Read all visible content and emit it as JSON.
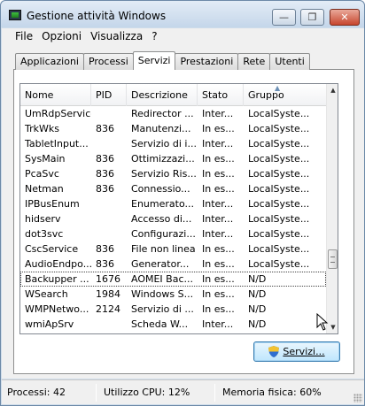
{
  "window": {
    "title": "Gestione attività Windows",
    "min_glyph": "—",
    "max_glyph": "❐",
    "close_glyph": "✕"
  },
  "menu": [
    "File",
    "Opzioni",
    "Visualizza",
    "?"
  ],
  "tabs": [
    "Applicazioni",
    "Processi",
    "Servizi",
    "Prestazioni",
    "Rete",
    "Utenti"
  ],
  "active_tab": "Servizi",
  "table": {
    "columns": [
      "Nome",
      "PID",
      "Descrizione",
      "Stato",
      "Gruppo"
    ],
    "sorted_column": "Gruppo",
    "rows": [
      [
        "UmRdpService",
        "",
        "Redirector ...",
        "Inter...",
        "LocalSyste..."
      ],
      [
        "TrkWks",
        "836",
        "Manutenzi...",
        "In es...",
        "LocalSyste..."
      ],
      [
        "TabletInput...",
        "",
        "Servizio di i...",
        "Inter...",
        "LocalSyste..."
      ],
      [
        "SysMain",
        "836",
        "Ottimizzazi...",
        "In es...",
        "LocalSyste..."
      ],
      [
        "PcaSvc",
        "836",
        "Servizio Ris...",
        "In es...",
        "LocalSyste..."
      ],
      [
        "Netman",
        "836",
        "Connessio...",
        "In es...",
        "LocalSyste..."
      ],
      [
        "IPBusEnum",
        "",
        "Enumerato...",
        "Inter...",
        "LocalSyste..."
      ],
      [
        "hidserv",
        "",
        "Accesso di...",
        "Inter...",
        "LocalSyste..."
      ],
      [
        "dot3svc",
        "",
        "Configurazi...",
        "Inter...",
        "LocalSyste..."
      ],
      [
        "CscService",
        "836",
        "File non linea",
        "In es...",
        "LocalSyste..."
      ],
      [
        "AudioEndpo...",
        "836",
        "Generator...",
        "In es...",
        "LocalSyste..."
      ],
      [
        "Backupper ...",
        "1676",
        "AOMEI Bac...",
        "In es...",
        "N/D"
      ],
      [
        "WSearch",
        "1984",
        "Windows S...",
        "In es...",
        "N/D"
      ],
      [
        "WMPNetwo...",
        "2124",
        "Servizio di ...",
        "In es...",
        "N/D"
      ],
      [
        "wmiApSrv",
        "",
        "Scheda W...",
        "Inter...",
        "N/D"
      ]
    ],
    "selected_row": 11
  },
  "services_button": "Servizi...",
  "status": {
    "processes": "Processi: 42",
    "cpu": "Utilizzo CPU: 12%",
    "memory": "Memoria fisica: 60%"
  }
}
